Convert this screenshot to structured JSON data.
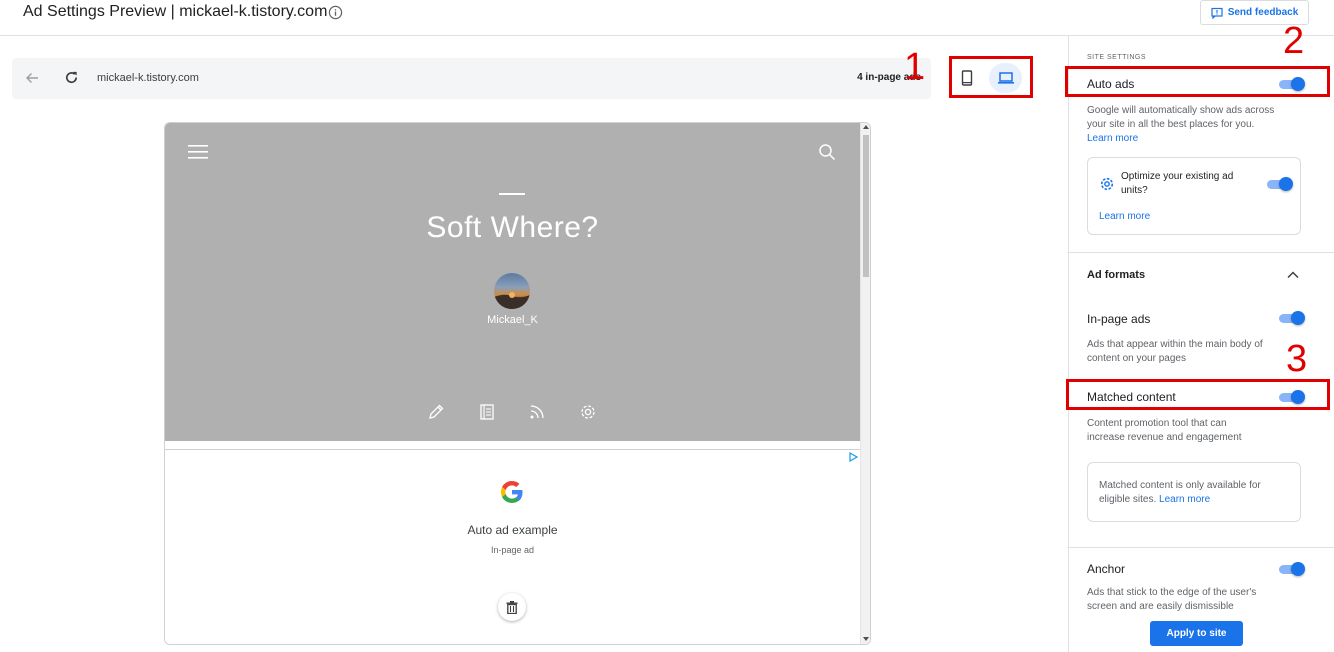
{
  "header": {
    "title": "Ad Settings Preview | mickael-k.tistory.com",
    "feedback_label": "Send feedback"
  },
  "browser": {
    "url": "mickael-k.tistory.com",
    "ads_count": "4 in-page ads"
  },
  "annotations": [
    "1",
    "2",
    "3"
  ],
  "preview": {
    "blog_title": "Soft Where?",
    "author": "Mickael_K",
    "ad_title": "Auto ad example",
    "ad_subtitle": "In-page ad"
  },
  "sidebar": {
    "section_label": "SITE SETTINGS",
    "auto_ads": {
      "label": "Auto ads",
      "desc": "Google will automatically show ads across your site in all the best places for you.",
      "learn_more": "Learn more",
      "enabled": true
    },
    "optimize": {
      "label": "Optimize your existing ad units?",
      "learn_more": "Learn more",
      "enabled": true
    },
    "ad_formats_label": "Ad formats",
    "in_page": {
      "label": "In-page ads",
      "desc": "Ads that appear within the main body of content on your pages",
      "enabled": true
    },
    "matched": {
      "label": "Matched content",
      "desc": "Content promotion tool that can increase revenue and engagement",
      "enabled": true
    },
    "matched_note": {
      "text": "Matched content is only available for eligible sites.",
      "learn_more": "Learn more"
    },
    "anchor": {
      "label": "Anchor",
      "desc": "Ads that stick to the edge of the user's screen and are easily dismissible",
      "enabled": true
    },
    "apply_label": "Apply to site"
  },
  "colors": {
    "accent": "#1a73e8",
    "annotation_red": "#e10000",
    "hero_gray": "#b0b0b0"
  }
}
